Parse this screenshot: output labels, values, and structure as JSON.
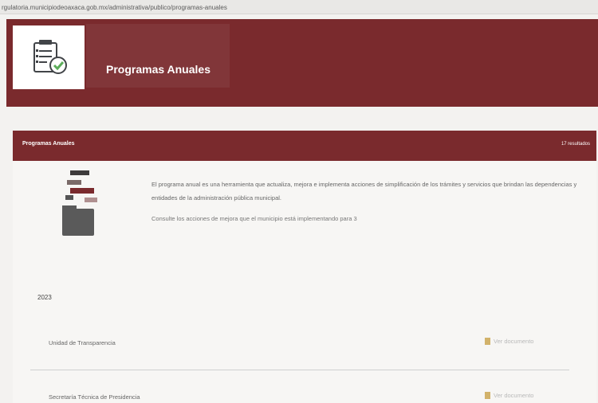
{
  "browser": {
    "url": "rgulatoria.municipiodeoaxaca.gob.mx/administrativa/publico/programas-anuales"
  },
  "hero": {
    "title": "Programas Anuales",
    "icon": "checklist-icon"
  },
  "card": {
    "header_title": "Programas Anuales",
    "header_meta": "17 resultados",
    "intro_text": "El programa anual es una herramienta que actualiza, mejora e implementa acciones de simplificación de los trámites y servicios que brindan las dependencias y entidades de la administración pública municipal.",
    "intro_text_2": "Consulte los acciones de mejora que el municipio está implementando para 3",
    "illustration": "documents-folder-icon"
  },
  "section": {
    "year": "2023",
    "rows": [
      {
        "label": "Unidad de Transparencia",
        "link": "Ver documento"
      },
      {
        "label": "Secretaría Técnica de Presidencia",
        "link": "Ver documento"
      }
    ]
  },
  "colors": {
    "brand": "#7a2a2d",
    "background": "#f3f2f0",
    "link": "#b9b9b9",
    "doc_icon": "#d2b26a"
  }
}
